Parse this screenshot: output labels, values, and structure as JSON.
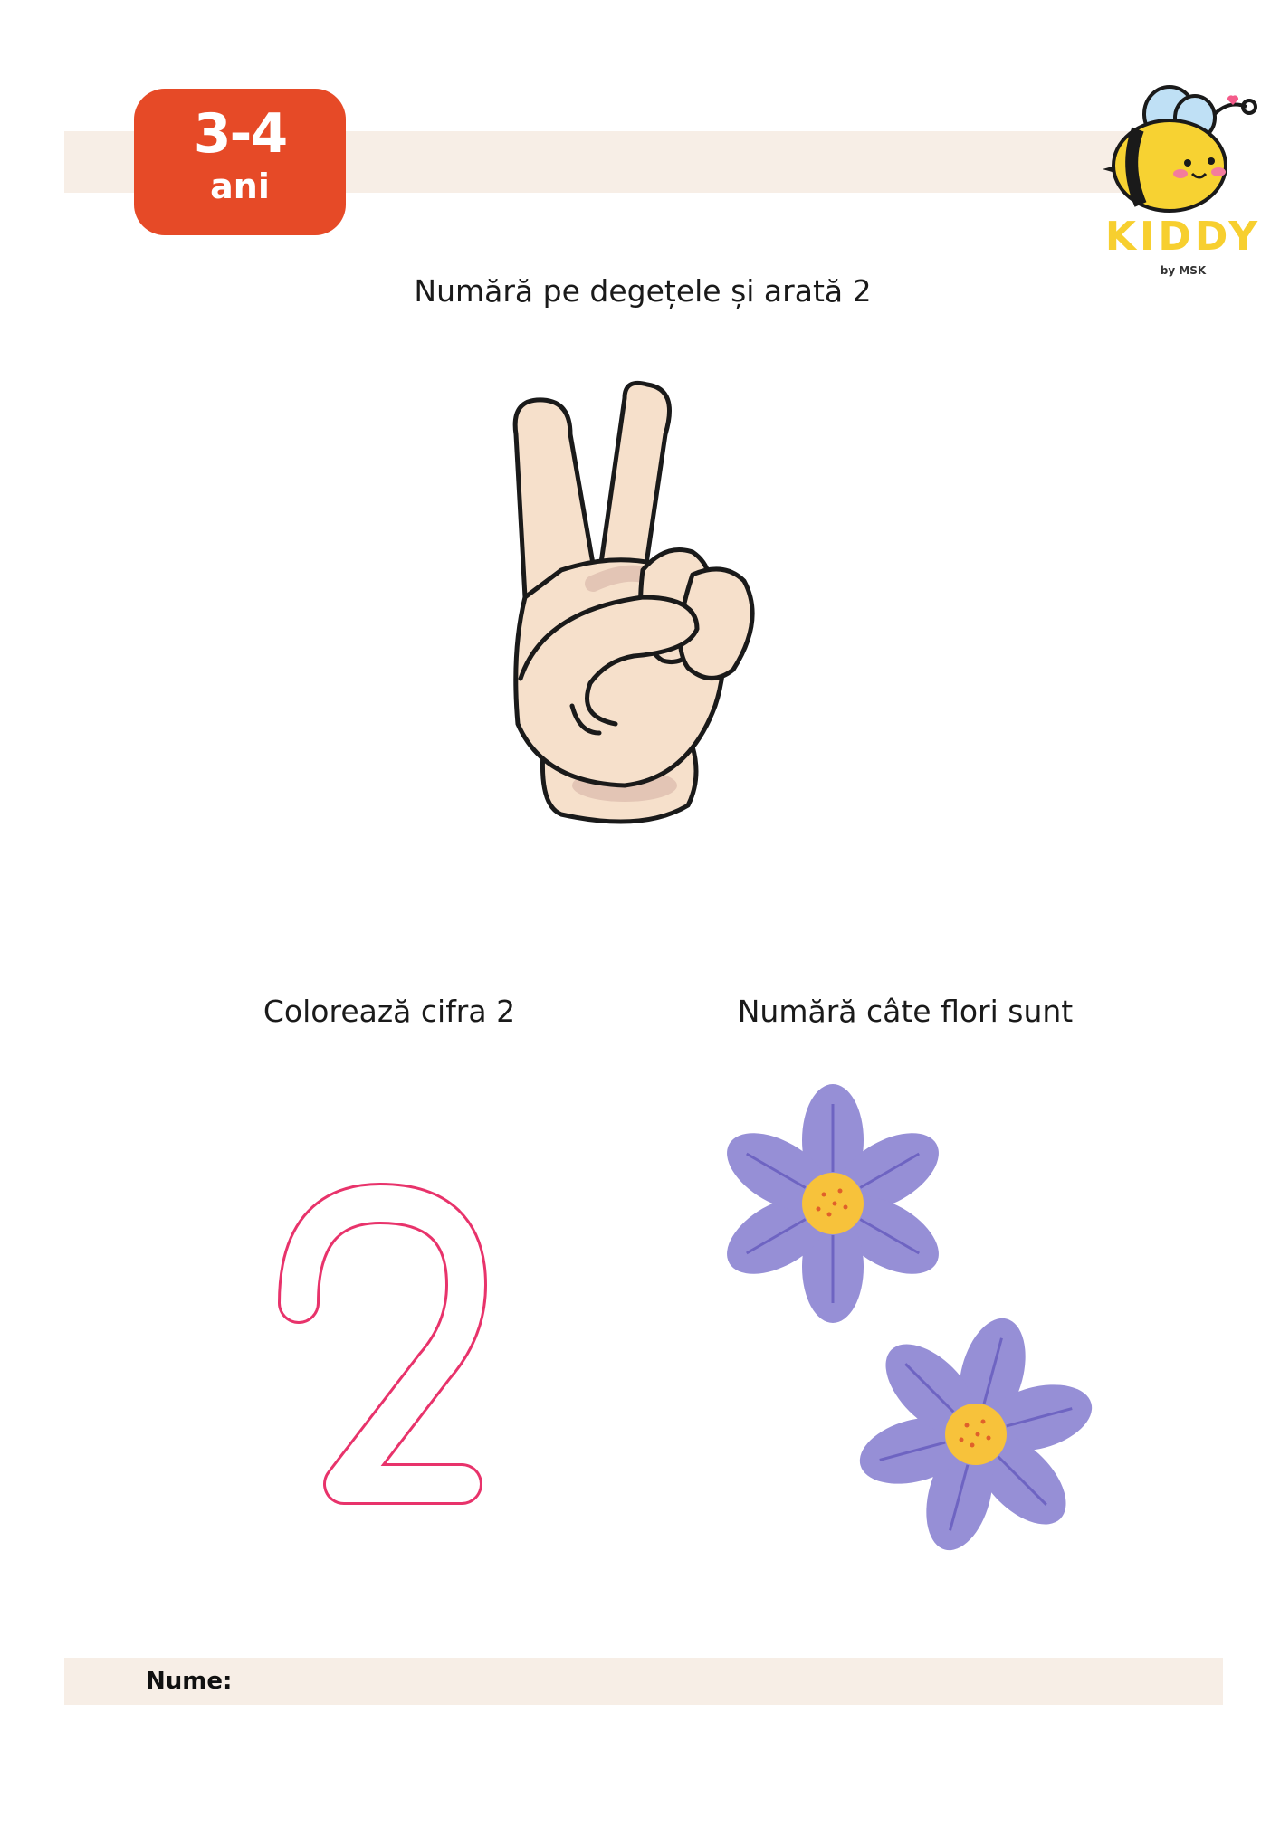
{
  "header": {
    "age_badge": {
      "range": "3-4",
      "unit": "ani"
    },
    "logo": {
      "name": "KIDDY",
      "byline": "by MSK",
      "icon": "bee-icon"
    }
  },
  "sections": {
    "hand": {
      "instruction": "Numără pe degețele și arată 2",
      "icon": "peace-hand-icon"
    },
    "color_digit": {
      "instruction": "Colorează cifra 2",
      "digit": "2"
    },
    "count_flowers": {
      "instruction": "Numără câte flori sunt",
      "flower_count": 2,
      "icon": "flower-icon"
    }
  },
  "footer": {
    "name_label": "Nume:"
  },
  "colors": {
    "badge": "#e64a27",
    "band": "#f7eee6",
    "digit_outline": "#e8336b",
    "petal": "#968fd6",
    "flower_center": "#f7c23b",
    "logo_text": "#f7cf2f",
    "skin": "#f6e0cb"
  }
}
